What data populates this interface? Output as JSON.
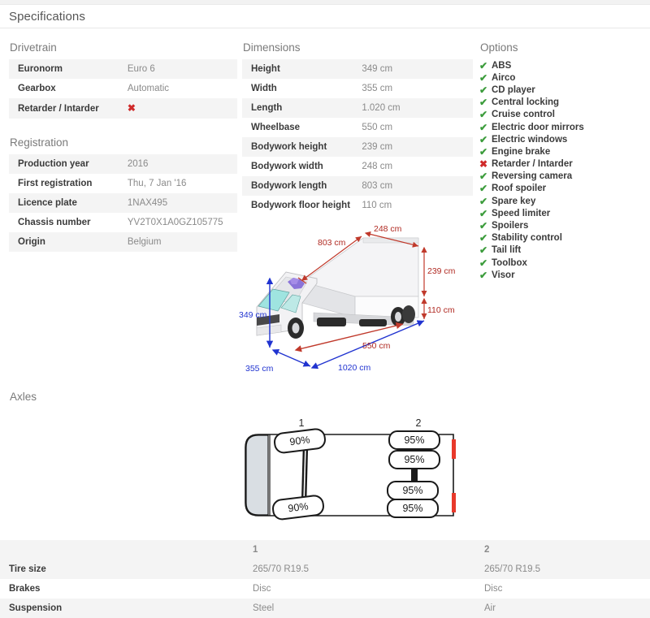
{
  "header": {
    "title": "Specifications"
  },
  "drivetrain": {
    "title": "Drivetrain",
    "rows": [
      {
        "key": "Euronorm",
        "value": "Euro 6"
      },
      {
        "key": "Gearbox",
        "value": "Automatic"
      },
      {
        "key": "Retarder / Intarder",
        "value": "✖",
        "mark": "no"
      }
    ]
  },
  "registration": {
    "title": "Registration",
    "rows": [
      {
        "key": "Production year",
        "value": "2016"
      },
      {
        "key": "First registration",
        "value": "Thu, 7 Jan '16"
      },
      {
        "key": "Licence plate",
        "value": "1NAX495"
      },
      {
        "key": "Chassis number",
        "value": "YV2T0X1A0GZ105775"
      },
      {
        "key": "Origin",
        "value": "Belgium"
      }
    ]
  },
  "dimensions": {
    "title": "Dimensions",
    "rows": [
      {
        "key": "Height",
        "value": "349 cm"
      },
      {
        "key": "Width",
        "value": "355 cm"
      },
      {
        "key": "Length",
        "value": "1.020 cm"
      },
      {
        "key": "Wheelbase",
        "value": "550 cm"
      },
      {
        "key": "Bodywork height",
        "value": "239 cm"
      },
      {
        "key": "Bodywork width",
        "value": "248 cm"
      },
      {
        "key": "Bodywork length",
        "value": "803 cm"
      },
      {
        "key": "Bodywork floor height",
        "value": "110 cm"
      }
    ],
    "diagram": {
      "name": "truck-dimensions-diagram",
      "red_color": "#c0392b",
      "blue_color": "#2033d0",
      "labels": {
        "bodywork_length": "803 cm",
        "bodywork_width": "248 cm",
        "bodywork_height": "239 cm",
        "floor_height": "110 cm",
        "total_height": "349 cm",
        "total_width": "355 cm",
        "wheelbase": "550 cm",
        "total_length": "1020 cm"
      }
    }
  },
  "options": {
    "title": "Options",
    "items": [
      {
        "label": "ABS",
        "mark": "yes"
      },
      {
        "label": "Airco",
        "mark": "yes"
      },
      {
        "label": "CD player",
        "mark": "yes"
      },
      {
        "label": "Central locking",
        "mark": "yes"
      },
      {
        "label": "Cruise control",
        "mark": "yes"
      },
      {
        "label": "Electric door mirrors",
        "mark": "yes"
      },
      {
        "label": "Electric windows",
        "mark": "yes"
      },
      {
        "label": "Engine brake",
        "mark": "yes"
      },
      {
        "label": "Retarder / Intarder",
        "mark": "no"
      },
      {
        "label": "Reversing camera",
        "mark": "yes"
      },
      {
        "label": "Roof spoiler",
        "mark": "yes"
      },
      {
        "label": "Spare key",
        "mark": "yes"
      },
      {
        "label": "Speed limiter",
        "mark": "yes"
      },
      {
        "label": "Spoilers",
        "mark": "yes"
      },
      {
        "label": "Stability control",
        "mark": "yes"
      },
      {
        "label": "Tail lift",
        "mark": "yes"
      },
      {
        "label": "Toolbox",
        "mark": "yes"
      },
      {
        "label": "Visor",
        "mark": "yes"
      }
    ],
    "icons": {
      "yes": "✔",
      "no": "✖"
    }
  },
  "axles": {
    "title": "Axles",
    "diagram": {
      "name": "axle-layout-diagram",
      "axle_numbers": [
        "1",
        "2"
      ],
      "tires": {
        "axle1": [
          "90%",
          "90%"
        ],
        "axle2": [
          "95%",
          "95%",
          "95%",
          "95%"
        ]
      }
    },
    "table": {
      "columns": [
        "",
        "1",
        "2"
      ],
      "rows": [
        {
          "key": "Tire size",
          "axle1": "265/70 R19.5",
          "axle2": "265/70 R19.5"
        },
        {
          "key": "Brakes",
          "axle1": "Disc",
          "axle2": "Disc"
        },
        {
          "key": "Suspension",
          "axle1": "Steel",
          "axle2": "Air"
        }
      ]
    }
  }
}
